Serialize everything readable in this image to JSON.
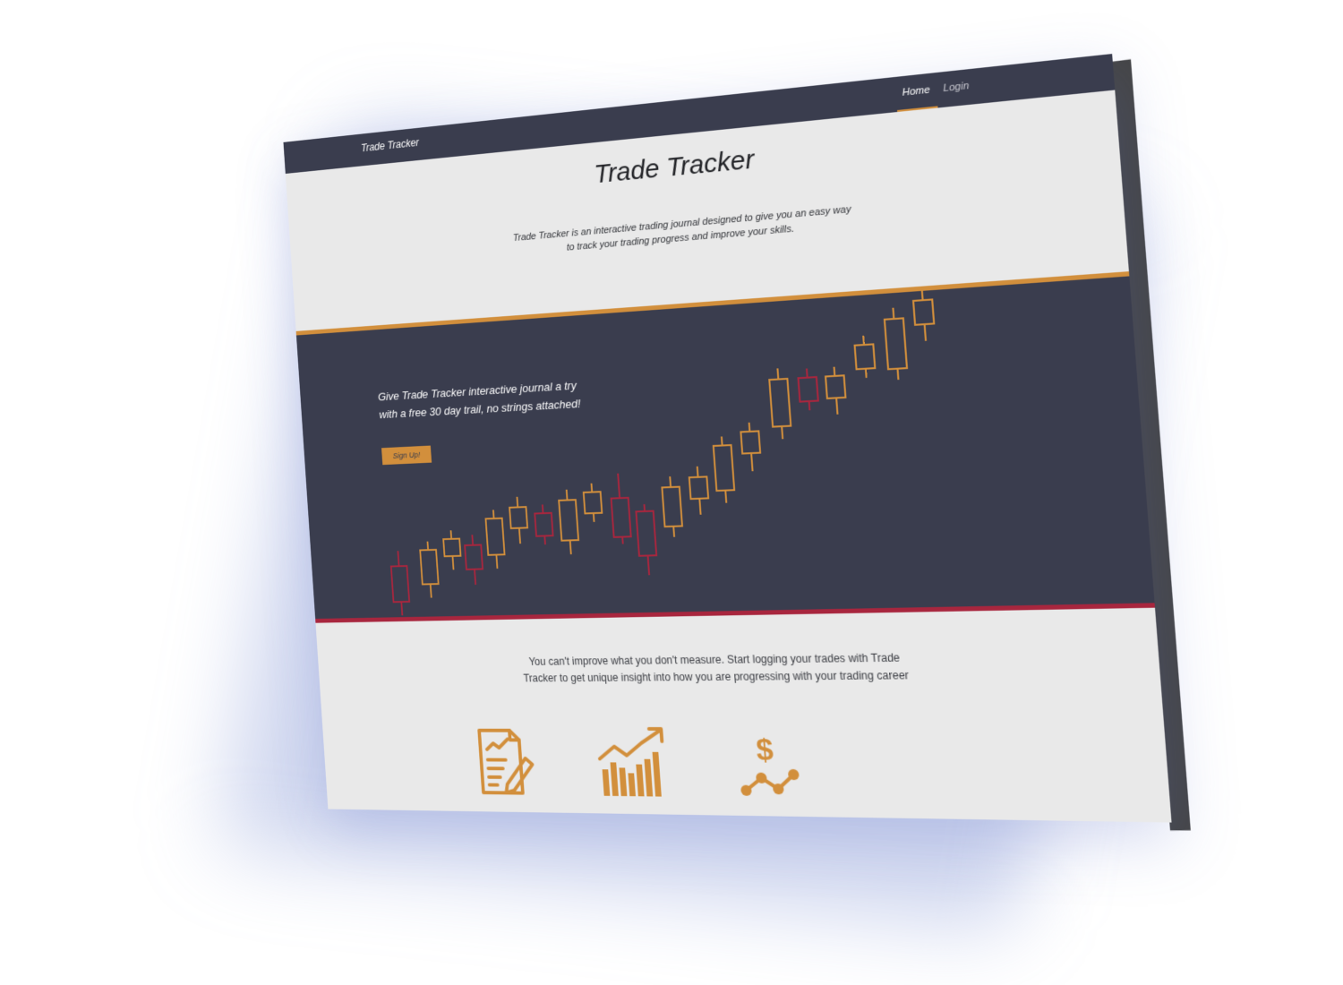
{
  "navbar": {
    "brand": "Trade Tracker",
    "links": [
      {
        "label": "Home",
        "active": true
      },
      {
        "label": "Login",
        "active": false
      }
    ]
  },
  "hero": {
    "title": "Trade Tracker",
    "description": "Trade Tracker is an interactive trading journal designed to give you an easy way to track your trading progress and improve your skills."
  },
  "band": {
    "text": "Give Trade Tracker interactive journal a try with a free 30 day trail, no strings attached!",
    "signup_label": "Sign Up!"
  },
  "bottom": {
    "text": "You can't improve what you don't measure. Start logging your trades with Trade Tracker to get unique insight into how you are progressing with your trading career"
  },
  "icons": [
    {
      "name": "journal-document-icon"
    },
    {
      "name": "growth-chart-icon"
    },
    {
      "name": "dollar-trend-icon"
    }
  ],
  "colors": {
    "navy": "#3a3d4e",
    "accent_orange": "#d28f3c",
    "accent_red": "#a8263e",
    "light_bg": "#e9e9e9"
  }
}
